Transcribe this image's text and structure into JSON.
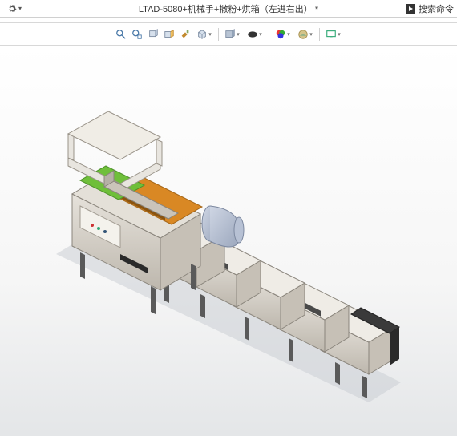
{
  "header": {
    "title": "LTAD-5080+机械手+撒粉+烘箱（左进右出） *",
    "search_label": "搜索命令"
  },
  "toolbar": {
    "items": [
      {
        "name": "zoom-fit-icon",
        "tip": "Zoom to Fit"
      },
      {
        "name": "zoom-area-icon",
        "tip": "Zoom to Area"
      },
      {
        "name": "prev-view-icon",
        "tip": "Previous View"
      },
      {
        "name": "section-view-icon",
        "tip": "Section View"
      },
      {
        "name": "view-orientation-icon",
        "tip": "View Orientation"
      },
      {
        "name": "display-style-icon",
        "tip": "Display Style"
      },
      {
        "name": "hide-show-icon",
        "tip": "Hide/Show Items"
      },
      {
        "name": "edit-appearance-icon",
        "tip": "Edit Appearance"
      },
      {
        "name": "apply-scene-icon",
        "tip": "Apply Scene"
      },
      {
        "name": "view-settings-icon",
        "tip": "View Settings"
      }
    ]
  },
  "model": {
    "name": "LTAD-5080 assembly",
    "colors": {
      "body": "#d2cdc6",
      "body_dark": "#aca69d",
      "panel": "#e8e5df",
      "accent_green": "#6fbf3a",
      "accent_orange": "#d98824",
      "accent_blue": "#8ea8c8",
      "frame": "#5a5a5a",
      "shadow": "#9aa2ab"
    }
  }
}
